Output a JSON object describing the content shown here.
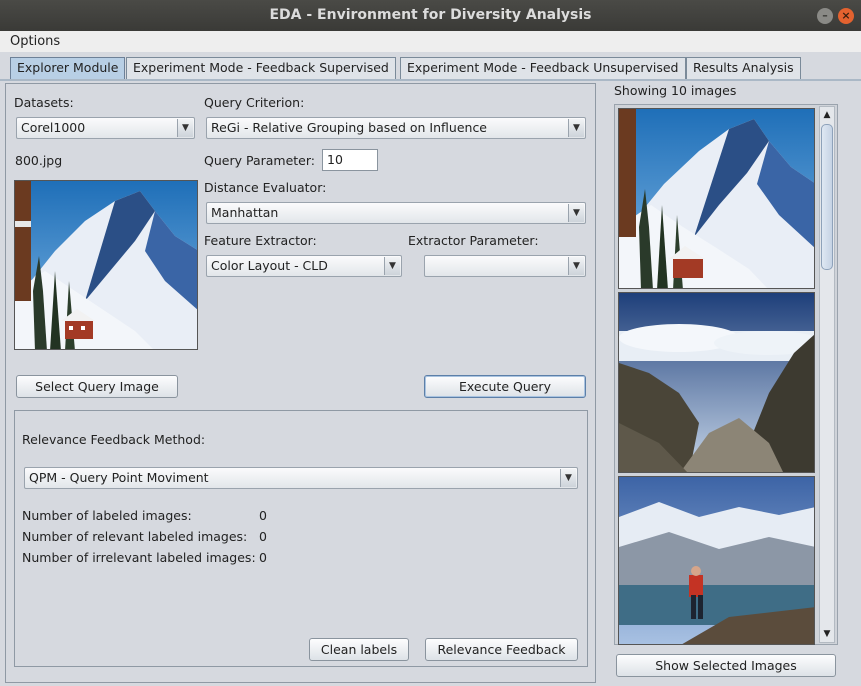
{
  "window": {
    "title": "EDA - Environment for Diversity Analysis"
  },
  "menu": {
    "options": "Options"
  },
  "tabs": [
    {
      "label": "Explorer Module",
      "active": true
    },
    {
      "label": "Experiment Mode - Feedback Supervised",
      "active": false
    },
    {
      "label": "Experiment Mode - Feedback Unsupervised",
      "active": false
    },
    {
      "label": "Results Analysis",
      "active": false
    }
  ],
  "explorer": {
    "datasets_label": "Datasets:",
    "datasets_value": "Corel1000",
    "query_image_name": "800.jpg",
    "query_criterion_label": "Query Criterion:",
    "query_criterion_value": "ReGi - Relative Grouping based on Influence",
    "query_parameter_label": "Query Parameter:",
    "query_parameter_value": "10",
    "distance_evaluator_label": "Distance Evaluator:",
    "distance_evaluator_value": "Manhattan",
    "feature_extractor_label": "Feature Extractor:",
    "feature_extractor_value": "Color Layout - CLD",
    "extractor_parameter_label": "Extractor Parameter:",
    "extractor_parameter_value": "",
    "select_query_image_button": "Select Query Image",
    "execute_query_button": "Execute Query"
  },
  "feedback": {
    "method_label": "Relevance Feedback Method:",
    "method_value": "QPM - Query Point Moviment",
    "labeled_label": "Number of labeled images:",
    "labeled_value": "0",
    "relevant_label": "Number of relevant labeled images:",
    "relevant_value": "0",
    "irrelevant_label": "Number of irrelevant labeled images:",
    "irrelevant_value": "0",
    "clean_labels_button": "Clean labels",
    "relevance_feedback_button": "Relevance Feedback"
  },
  "results": {
    "showing_label": "Showing 10 images",
    "show_selected_button": "Show Selected Images"
  },
  "colors": {
    "titlebar": "#3f3f3c",
    "window_bg": "#d6d9df",
    "tab_active": "#b8cfe5",
    "close_button": "#e3622f"
  },
  "icons": [
    "minimize-icon",
    "close-icon",
    "chevron-down-icon",
    "scroll-up-icon",
    "scroll-down-icon"
  ]
}
